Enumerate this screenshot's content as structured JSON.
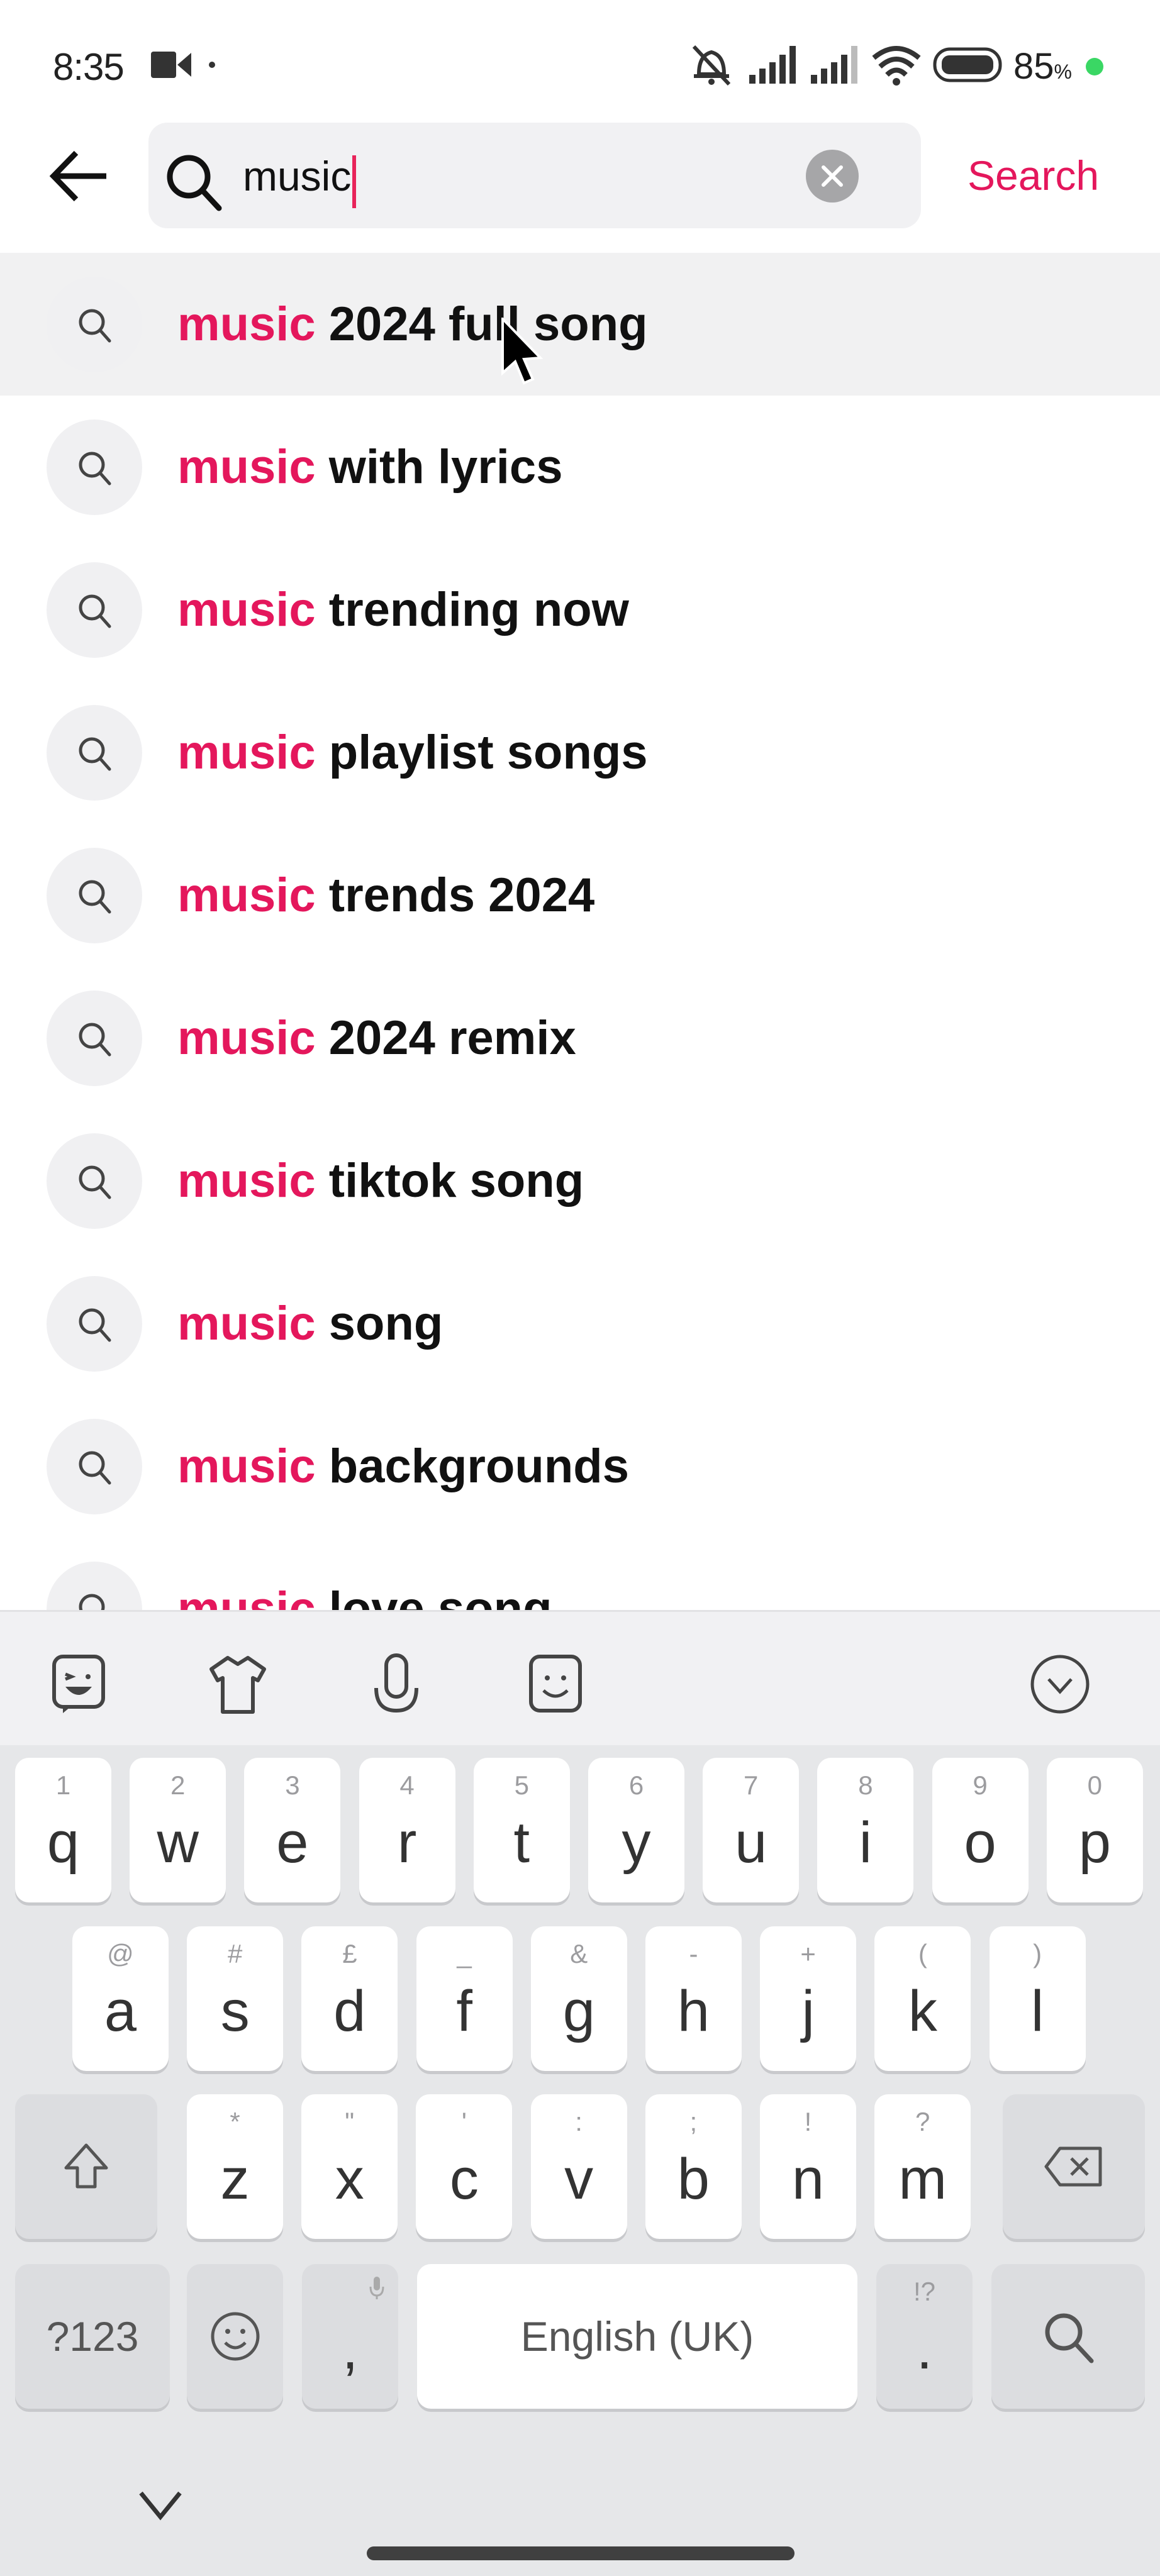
{
  "status_bar": {
    "time": "8:35",
    "battery_percent": "85",
    "battery_suffix": "%",
    "icons": [
      "video-record-icon",
      "notification-dot-icon",
      "mute-icon",
      "signal-icon",
      "signal-icon-2",
      "wifi-icon",
      "battery-icon",
      "charging-dot-icon"
    ]
  },
  "header": {
    "back_icon": "arrow-left-icon",
    "search_icon": "search-icon",
    "query": "music",
    "clear_icon": "close-circle-icon",
    "search_button": "Search"
  },
  "colors": {
    "accent": "#e4175c",
    "search_bg": "#f1f1f3",
    "keyboard_bg": "#e6e7e9"
  },
  "suggestions": [
    {
      "highlight": "music",
      "rest": " 2024 full song",
      "active": true
    },
    {
      "highlight": "music",
      "rest": " with lyrics"
    },
    {
      "highlight": "music",
      "rest": " trending now"
    },
    {
      "highlight": "music",
      "rest": " playlist songs"
    },
    {
      "highlight": "music",
      "rest": " trends 2024"
    },
    {
      "highlight": "music",
      "rest": " 2024 remix"
    },
    {
      "highlight": "music",
      "rest": " tiktok song"
    },
    {
      "highlight": "music",
      "rest": " song"
    },
    {
      "highlight": "music",
      "rest": " backgrounds"
    },
    {
      "highlight": "music",
      "rest": " love song"
    }
  ],
  "keyboard": {
    "toolbar": [
      "sticker-icon",
      "theme-shirt-icon",
      "microphone-icon",
      "emoji-pad-icon",
      "collapse-keyboard-icon"
    ],
    "row1": [
      {
        "key": "q",
        "hint": "1"
      },
      {
        "key": "w",
        "hint": "2"
      },
      {
        "key": "e",
        "hint": "3"
      },
      {
        "key": "r",
        "hint": "4"
      },
      {
        "key": "t",
        "hint": "5"
      },
      {
        "key": "y",
        "hint": "6"
      },
      {
        "key": "u",
        "hint": "7"
      },
      {
        "key": "i",
        "hint": "8"
      },
      {
        "key": "o",
        "hint": "9"
      },
      {
        "key": "p",
        "hint": "0"
      }
    ],
    "row2": [
      {
        "key": "a",
        "hint": "@"
      },
      {
        "key": "s",
        "hint": "#"
      },
      {
        "key": "d",
        "hint": "£"
      },
      {
        "key": "f",
        "hint": "_"
      },
      {
        "key": "g",
        "hint": "&"
      },
      {
        "key": "h",
        "hint": "-"
      },
      {
        "key": "j",
        "hint": "+"
      },
      {
        "key": "k",
        "hint": "("
      },
      {
        "key": "l",
        "hint": ")"
      }
    ],
    "row3": [
      {
        "key": "z",
        "hint": "*"
      },
      {
        "key": "x",
        "hint": "\""
      },
      {
        "key": "c",
        "hint": "'"
      },
      {
        "key": "v",
        "hint": ":"
      },
      {
        "key": "b",
        "hint": ";"
      },
      {
        "key": "n",
        "hint": "!"
      },
      {
        "key": "m",
        "hint": "?"
      }
    ],
    "shift_icon": "shift-icon",
    "backspace_icon": "backspace-icon",
    "symbols_label": "?123",
    "emoji_icon": "emoji-icon",
    "comma_label": ",",
    "comma_hint_icon": "microphone-icon",
    "space_label": "English (UK)",
    "period_label": ".",
    "period_hint": "!?",
    "enter_icon": "search-icon"
  },
  "nav": {
    "hide_keyboard_icon": "chevron-down-icon",
    "home_indicator": "home-bar"
  }
}
